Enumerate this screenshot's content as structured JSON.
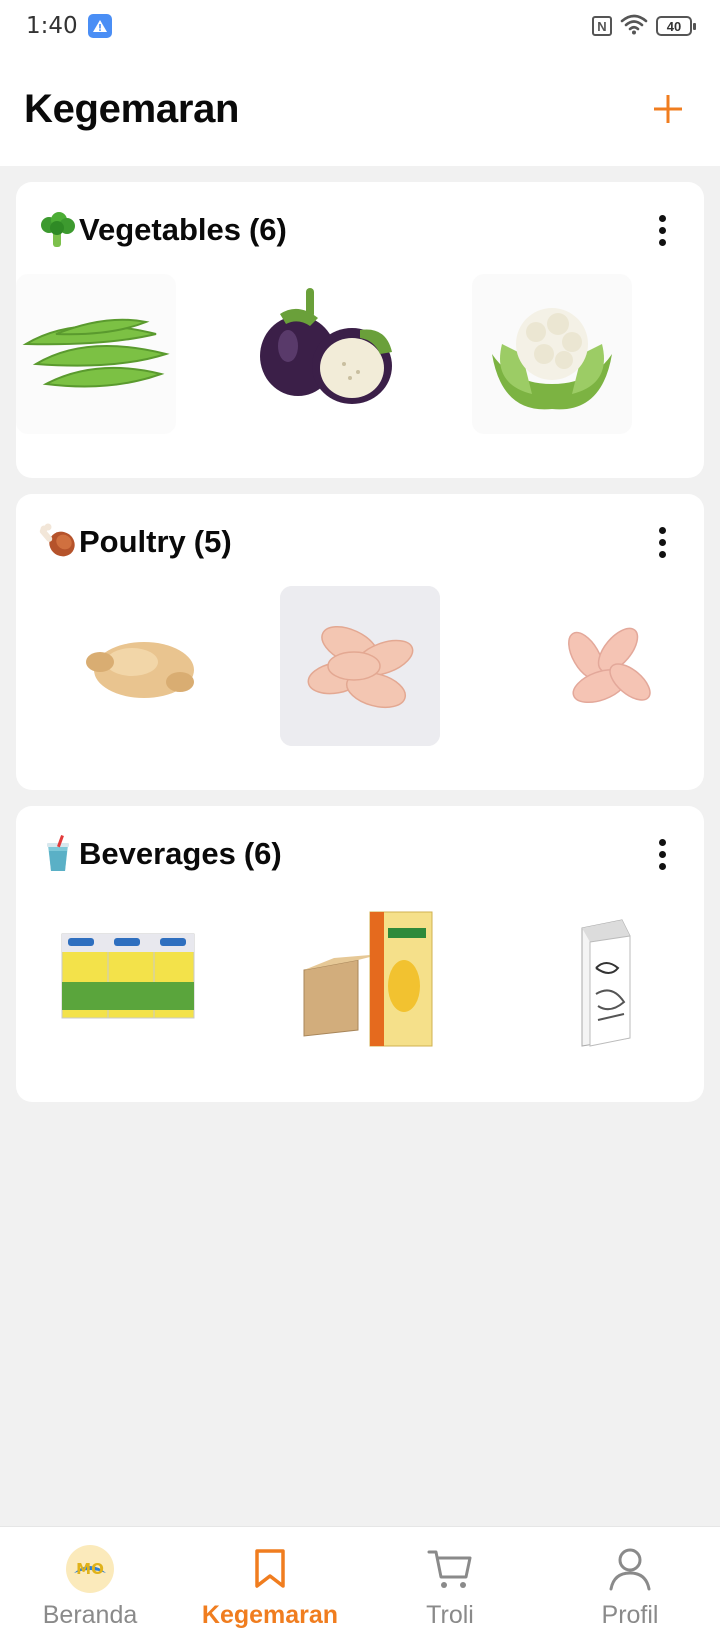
{
  "status_bar": {
    "time": "1:40",
    "battery": "40"
  },
  "header": {
    "title": "Kegemaran"
  },
  "categories": [
    {
      "name": "Vegetables",
      "count": "(6)",
      "emoji": "broccoli-icon",
      "items": [
        "winged-beans",
        "eggplant",
        "cauliflower"
      ]
    },
    {
      "name": "Poultry",
      "count": "(5)",
      "emoji": "poultry-leg-icon",
      "items": [
        "whole-chicken",
        "chicken-drumsticks-packed",
        "chicken-drumsticks"
      ]
    },
    {
      "name": "Beverages",
      "count": "(6)",
      "emoji": "cup-with-straw-icon",
      "items": [
        "soya-milk-pack",
        "seasons-corn-soya-carton",
        "fresh-milk-carton"
      ]
    }
  ],
  "bottom_nav": {
    "items": [
      {
        "label": "Beranda",
        "icon": "home-logo-icon",
        "active": false
      },
      {
        "label": "Kegemaran",
        "icon": "bookmark-icon",
        "active": true
      },
      {
        "label": "Troli",
        "icon": "cart-icon",
        "active": false
      },
      {
        "label": "Profil",
        "icon": "profile-icon",
        "active": false
      }
    ]
  },
  "colors": {
    "accent": "#f07d1f",
    "background": "#f1f1f1",
    "card": "#ffffff",
    "inactive": "#8a8a8a"
  }
}
